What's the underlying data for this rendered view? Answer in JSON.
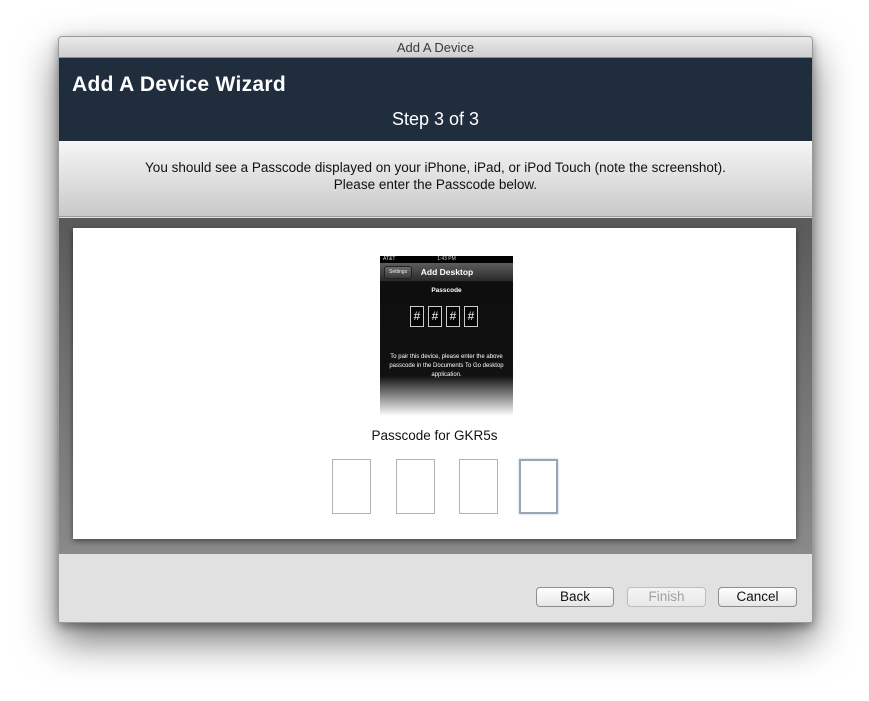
{
  "window": {
    "title": "Add A Device"
  },
  "header": {
    "title": "Add A Device Wizard",
    "step": "Step 3 of 3"
  },
  "instructions": {
    "line1": "You should see a Passcode displayed on your iPhone, iPad, or iPod Touch (note the screenshot).",
    "line2": "Please enter the Passcode below."
  },
  "phone_screenshot": {
    "carrier": "AT&T",
    "time": "1:43 PM",
    "back_button": "Settings",
    "nav_title": "Add Desktop",
    "passcode_label": "Passcode",
    "digits": [
      "#",
      "#",
      "#",
      "#"
    ],
    "info": "To pair this device, please enter the above passcode in the Documents To Go desktop application."
  },
  "passcode": {
    "label": "Passcode for GKR5s",
    "values": [
      "",
      "",
      "",
      ""
    ]
  },
  "footer": {
    "back_label": "Back",
    "finish_label": "Finish",
    "cancel_label": "Cancel"
  }
}
